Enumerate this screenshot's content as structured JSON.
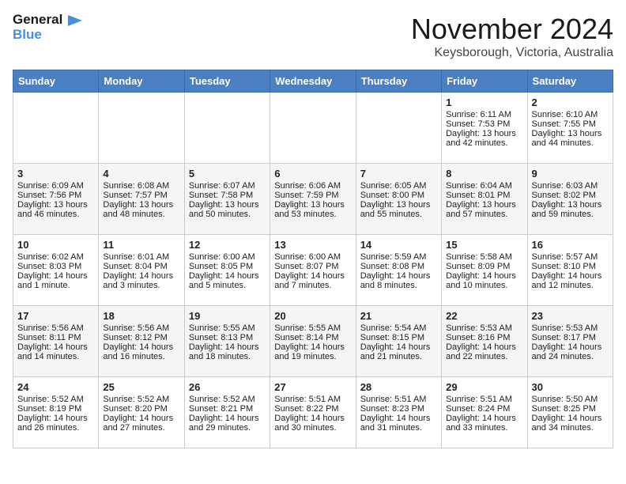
{
  "header": {
    "logo_line1": "General",
    "logo_line2": "Blue",
    "month": "November 2024",
    "location": "Keysborough, Victoria, Australia"
  },
  "days_of_week": [
    "Sunday",
    "Monday",
    "Tuesday",
    "Wednesday",
    "Thursday",
    "Friday",
    "Saturday"
  ],
  "weeks": [
    [
      {
        "day": "",
        "info": ""
      },
      {
        "day": "",
        "info": ""
      },
      {
        "day": "",
        "info": ""
      },
      {
        "day": "",
        "info": ""
      },
      {
        "day": "",
        "info": ""
      },
      {
        "day": "1",
        "info": "Sunrise: 6:11 AM\nSunset: 7:53 PM\nDaylight: 13 hours\nand 42 minutes."
      },
      {
        "day": "2",
        "info": "Sunrise: 6:10 AM\nSunset: 7:55 PM\nDaylight: 13 hours\nand 44 minutes."
      }
    ],
    [
      {
        "day": "3",
        "info": "Sunrise: 6:09 AM\nSunset: 7:56 PM\nDaylight: 13 hours\nand 46 minutes."
      },
      {
        "day": "4",
        "info": "Sunrise: 6:08 AM\nSunset: 7:57 PM\nDaylight: 13 hours\nand 48 minutes."
      },
      {
        "day": "5",
        "info": "Sunrise: 6:07 AM\nSunset: 7:58 PM\nDaylight: 13 hours\nand 50 minutes."
      },
      {
        "day": "6",
        "info": "Sunrise: 6:06 AM\nSunset: 7:59 PM\nDaylight: 13 hours\nand 53 minutes."
      },
      {
        "day": "7",
        "info": "Sunrise: 6:05 AM\nSunset: 8:00 PM\nDaylight: 13 hours\nand 55 minutes."
      },
      {
        "day": "8",
        "info": "Sunrise: 6:04 AM\nSunset: 8:01 PM\nDaylight: 13 hours\nand 57 minutes."
      },
      {
        "day": "9",
        "info": "Sunrise: 6:03 AM\nSunset: 8:02 PM\nDaylight: 13 hours\nand 59 minutes."
      }
    ],
    [
      {
        "day": "10",
        "info": "Sunrise: 6:02 AM\nSunset: 8:03 PM\nDaylight: 14 hours\nand 1 minute."
      },
      {
        "day": "11",
        "info": "Sunrise: 6:01 AM\nSunset: 8:04 PM\nDaylight: 14 hours\nand 3 minutes."
      },
      {
        "day": "12",
        "info": "Sunrise: 6:00 AM\nSunset: 8:05 PM\nDaylight: 14 hours\nand 5 minutes."
      },
      {
        "day": "13",
        "info": "Sunrise: 6:00 AM\nSunset: 8:07 PM\nDaylight: 14 hours\nand 7 minutes."
      },
      {
        "day": "14",
        "info": "Sunrise: 5:59 AM\nSunset: 8:08 PM\nDaylight: 14 hours\nand 8 minutes."
      },
      {
        "day": "15",
        "info": "Sunrise: 5:58 AM\nSunset: 8:09 PM\nDaylight: 14 hours\nand 10 minutes."
      },
      {
        "day": "16",
        "info": "Sunrise: 5:57 AM\nSunset: 8:10 PM\nDaylight: 14 hours\nand 12 minutes."
      }
    ],
    [
      {
        "day": "17",
        "info": "Sunrise: 5:56 AM\nSunset: 8:11 PM\nDaylight: 14 hours\nand 14 minutes."
      },
      {
        "day": "18",
        "info": "Sunrise: 5:56 AM\nSunset: 8:12 PM\nDaylight: 14 hours\nand 16 minutes."
      },
      {
        "day": "19",
        "info": "Sunrise: 5:55 AM\nSunset: 8:13 PM\nDaylight: 14 hours\nand 18 minutes."
      },
      {
        "day": "20",
        "info": "Sunrise: 5:55 AM\nSunset: 8:14 PM\nDaylight: 14 hours\nand 19 minutes."
      },
      {
        "day": "21",
        "info": "Sunrise: 5:54 AM\nSunset: 8:15 PM\nDaylight: 14 hours\nand 21 minutes."
      },
      {
        "day": "22",
        "info": "Sunrise: 5:53 AM\nSunset: 8:16 PM\nDaylight: 14 hours\nand 22 minutes."
      },
      {
        "day": "23",
        "info": "Sunrise: 5:53 AM\nSunset: 8:17 PM\nDaylight: 14 hours\nand 24 minutes."
      }
    ],
    [
      {
        "day": "24",
        "info": "Sunrise: 5:52 AM\nSunset: 8:19 PM\nDaylight: 14 hours\nand 26 minutes."
      },
      {
        "day": "25",
        "info": "Sunrise: 5:52 AM\nSunset: 8:20 PM\nDaylight: 14 hours\nand 27 minutes."
      },
      {
        "day": "26",
        "info": "Sunrise: 5:52 AM\nSunset: 8:21 PM\nDaylight: 14 hours\nand 29 minutes."
      },
      {
        "day": "27",
        "info": "Sunrise: 5:51 AM\nSunset: 8:22 PM\nDaylight: 14 hours\nand 30 minutes."
      },
      {
        "day": "28",
        "info": "Sunrise: 5:51 AM\nSunset: 8:23 PM\nDaylight: 14 hours\nand 31 minutes."
      },
      {
        "day": "29",
        "info": "Sunrise: 5:51 AM\nSunset: 8:24 PM\nDaylight: 14 hours\nand 33 minutes."
      },
      {
        "day": "30",
        "info": "Sunrise: 5:50 AM\nSunset: 8:25 PM\nDaylight: 14 hours\nand 34 minutes."
      }
    ]
  ]
}
